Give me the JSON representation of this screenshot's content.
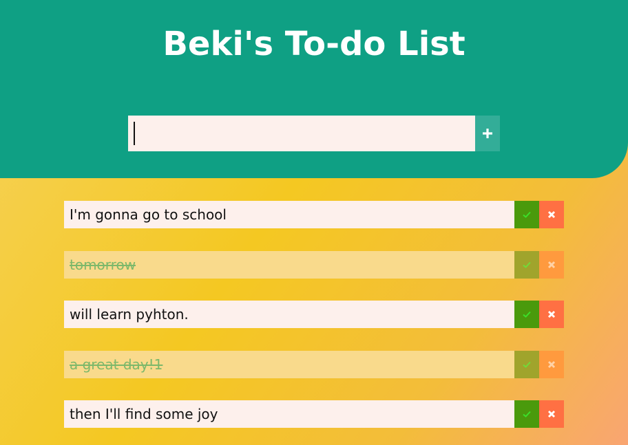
{
  "header": {
    "title": "Beki's To-do List",
    "background_color": "#0fa084"
  },
  "new_item": {
    "value": "",
    "placeholder": "",
    "add_icon": "plus-icon"
  },
  "todos": [
    {
      "text": "I'm gonna go to school",
      "completed": false
    },
    {
      "text": "tomorrow",
      "completed": true
    },
    {
      "text": "will learn pyhton.",
      "completed": false
    },
    {
      "text": "a great day!1",
      "completed": true
    },
    {
      "text": "then I'll find some joy",
      "completed": false
    }
  ],
  "icons": {
    "done": "check-icon",
    "remove": "close-icon"
  },
  "colors": {
    "done_button": "#4a9a0c",
    "remove_button": "#ff7043",
    "item_background": "#fdf0ec"
  }
}
